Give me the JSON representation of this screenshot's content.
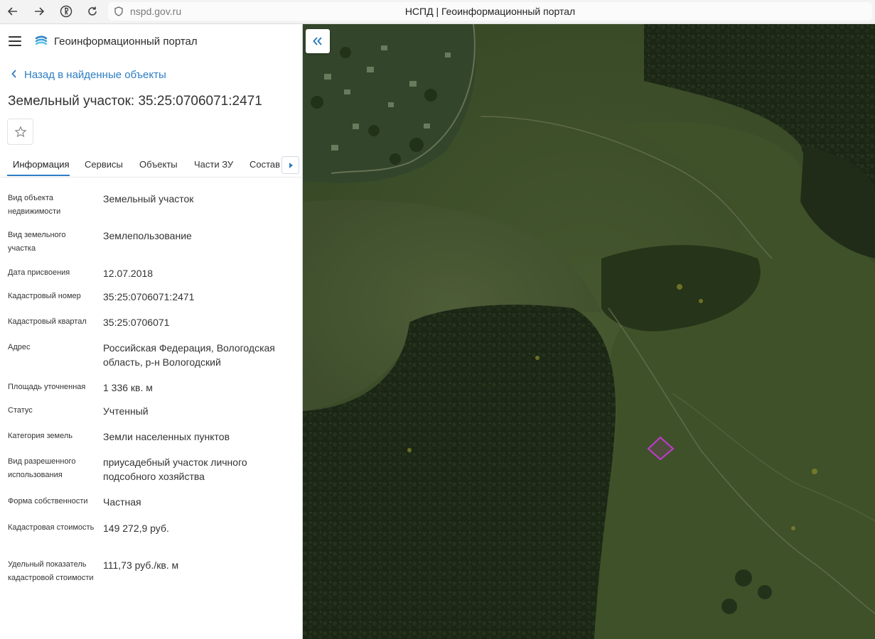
{
  "browser": {
    "url": "nspd.gov.ru",
    "tab_title": "НСПД | Геоинформационный портал"
  },
  "app": {
    "title": "Геоинформационный портал"
  },
  "back_link": "Назад в найденные объекты",
  "heading": "Земельный участок: 35:25:0706071:2471",
  "tabs": [
    {
      "label": "Информация",
      "active": true
    },
    {
      "label": "Сервисы"
    },
    {
      "label": "Объекты"
    },
    {
      "label": "Части ЗУ"
    },
    {
      "label": "Состав"
    }
  ],
  "fields": [
    {
      "label": "Вид объекта недвижимости",
      "value": "Земельный участок"
    },
    {
      "label": "Вид земельного участка",
      "value": "Землепользование"
    },
    {
      "label": "Дата присвоения",
      "value": "12.07.2018"
    },
    {
      "label": "Кадастровый номер",
      "value": "35:25:0706071:2471"
    },
    {
      "label": "Кадастровый квартал",
      "value": "35:25:0706071"
    },
    {
      "label": "Адрес",
      "value": "Российская Федерация, Вологодская область, р-н Вологодский"
    },
    {
      "label": "Площадь уточненная",
      "value": "1 336 кв. м"
    },
    {
      "label": "Статус",
      "value": "Учтенный"
    },
    {
      "label": "Категория земель",
      "value": "Земли населенных пунктов"
    },
    {
      "label": "Вид разрешенного использования",
      "value": "приусадебный участок личного подсобного хозяйства"
    },
    {
      "label": "Форма собственности",
      "value": "Частная"
    },
    {
      "label": "Кадастровая стоимость",
      "value": "149 272,9 руб."
    },
    {
      "label": "Удельный показатель кадастровой стоимости",
      "value": "111,73 руб./кв. м"
    }
  ],
  "colors": {
    "accent": "#2d7dc4",
    "parcel_outline": "#c23ad0"
  }
}
